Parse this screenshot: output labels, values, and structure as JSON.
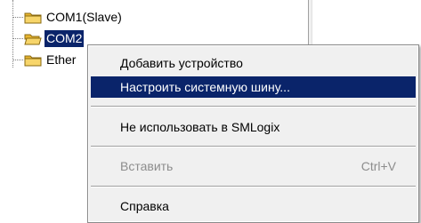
{
  "tree": {
    "nodes": [
      {
        "label": "COM1(Slave)",
        "selected": false
      },
      {
        "label": "COM2",
        "selected": true
      },
      {
        "label": "Ether",
        "selected": false
      }
    ]
  },
  "context_menu": {
    "items": [
      {
        "label": "Добавить устройство",
        "state": "normal"
      },
      {
        "label": "Настроить системную шину...",
        "state": "highlighted"
      },
      {
        "label": "Не использовать в SMLogix",
        "state": "normal"
      },
      {
        "label": "Вставить",
        "shortcut": "Ctrl+V",
        "state": "disabled"
      },
      {
        "label": "Справка",
        "state": "normal"
      }
    ]
  },
  "colors": {
    "selection": "#0a246a",
    "menu_background": "#f0f0f0",
    "folder": "#f2c94c",
    "disabled_text": "#8d8d8d"
  },
  "icons": {
    "tree_node": "folder-icon"
  }
}
